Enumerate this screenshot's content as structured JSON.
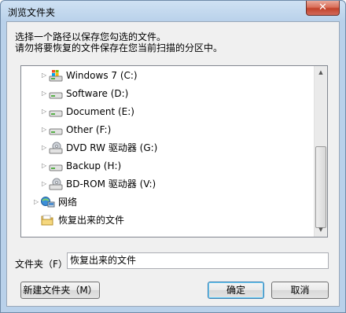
{
  "window": {
    "title": "浏览文件夹",
    "close_glyph": "✕"
  },
  "description": {
    "line1": "选择一个路径以保存您勾选的文件。",
    "line2": "请勿将要恢复的文件保存在您当前扫描的分区中。"
  },
  "tree": {
    "items": [
      {
        "label": "Windows 7 (C:)",
        "icon": "windows-drive-icon",
        "expander": "▷"
      },
      {
        "label": "Software (D:)",
        "icon": "hard-drive-icon",
        "expander": "▷"
      },
      {
        "label": "Document (E:)",
        "icon": "hard-drive-icon",
        "expander": "▷"
      },
      {
        "label": "Other (F:)",
        "icon": "hard-drive-icon",
        "expander": "▷"
      },
      {
        "label": "DVD RW 驱动器 (G:)",
        "icon": "optical-drive-icon",
        "expander": "▷"
      },
      {
        "label": "Backup (H:)",
        "icon": "hard-drive-icon",
        "expander": "▷"
      },
      {
        "label": "BD-ROM 驱动器 (V:)",
        "icon": "optical-drive-icon",
        "expander": "▷"
      },
      {
        "label": "网络",
        "icon": "network-icon",
        "expander": "▷"
      },
      {
        "label": "恢复出来的文件",
        "icon": "folder-icon",
        "expander": "",
        "selected": true
      }
    ],
    "scroll_up": "▲",
    "scroll_down": "▼"
  },
  "folder": {
    "label": "文件夹（F）:",
    "value": "恢复出来的文件"
  },
  "buttons": {
    "new_folder": "新建文件夹（M）",
    "ok": "确定",
    "cancel": "取消"
  },
  "colors": {
    "title_gradient_top": "#cfe1f3",
    "selection_border": "#99c9ef",
    "close_red": "#c2432b"
  }
}
